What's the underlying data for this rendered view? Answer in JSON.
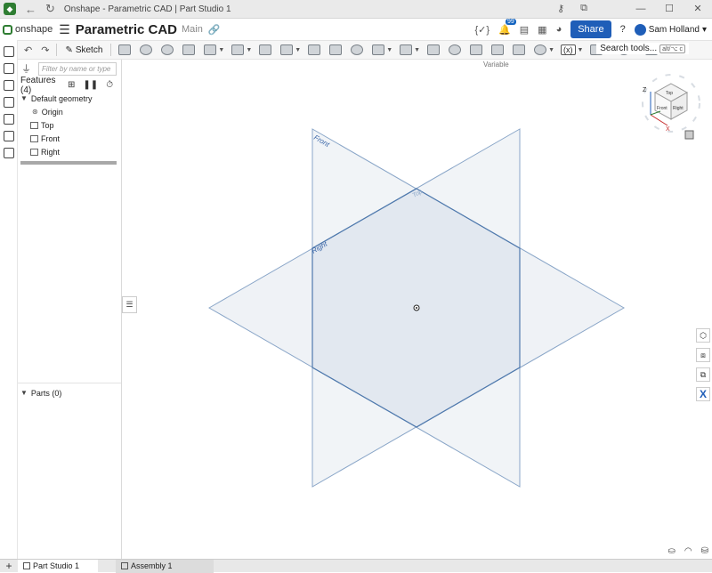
{
  "titlebar": {
    "title": "Onshape - Parametric CAD | Part Studio 1",
    "back_glyph": "←",
    "reload_glyph": "↻",
    "minimize": "—",
    "maximize": "☐",
    "close": "✕"
  },
  "appbar": {
    "logo_text": "onshape",
    "document_title": "Parametric CAD",
    "branch": "Main",
    "share_label": "Share",
    "user_name": "Sam Holland",
    "notification_count": "99",
    "help_glyph": "?"
  },
  "toolbar": {
    "sketch_label": "Sketch",
    "variable_label": "(x)",
    "search_label": "Search tools...",
    "search_shortcut": "alt/⌥ c",
    "tooltip": "Variable"
  },
  "feature_panel": {
    "filter_placeholder": "Filter by name or type",
    "features_header": "Features (4)",
    "default_geometry": "Default geometry",
    "items": [
      {
        "label": "Origin"
      },
      {
        "label": "Top"
      },
      {
        "label": "Front"
      },
      {
        "label": "Right"
      }
    ],
    "parts_header": "Parts (0)"
  },
  "viewport": {
    "plane_labels": {
      "front": "Front",
      "top": "Top",
      "right": "Right"
    },
    "view_cube": {
      "top": "Top",
      "front": "Front",
      "right": "Right",
      "z": "Z",
      "x": "X"
    }
  },
  "tabs": [
    {
      "label": "Part Studio 1",
      "active": true
    },
    {
      "label": "Assembly 1",
      "active": false
    }
  ],
  "colors": {
    "accent": "#1f5eb8",
    "plane_fill": "#e4eaf0",
    "plane_edge": "#8aa6c8"
  }
}
